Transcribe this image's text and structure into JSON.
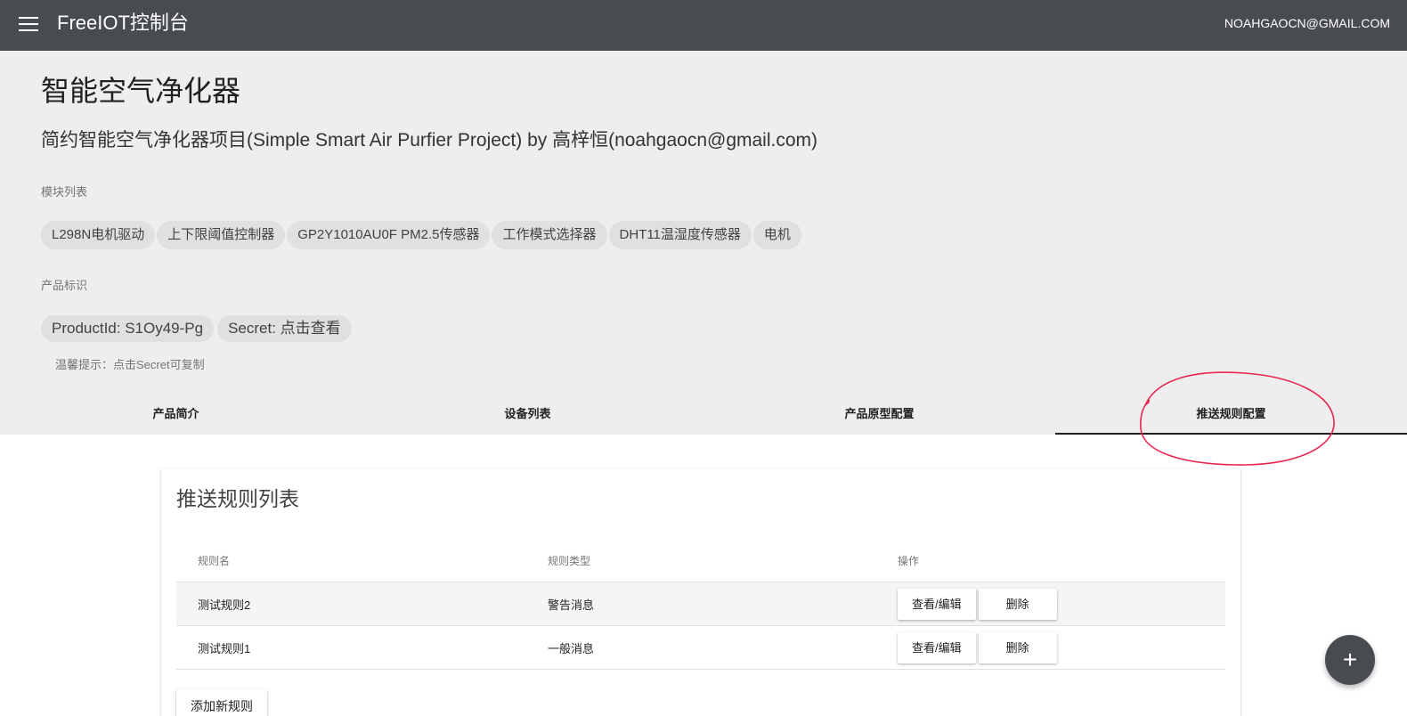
{
  "topbar": {
    "menu_icon": "menu-icon",
    "title": "FreeIOT控制台",
    "user_email": "NOAHGAOCN@GMAIL.COM"
  },
  "product": {
    "name": "智能空气净化器",
    "description": "简约智能空气净化器项目(Simple Smart Air Purfier Project) by 高梓恒(noahgaocn@gmail.com)",
    "modules_label": "模块列表",
    "modules": [
      "L298N电机驱动",
      "上下限阈值控制器",
      "GP2Y1010AU0F PM2.5传感器",
      "工作模式选择器",
      "DHT11温湿度传感器",
      "电机"
    ],
    "identity_label": "产品标识",
    "product_id": "ProductId: S1Oy49-Pg",
    "secret": "Secret: 点击查看",
    "hint": "温馨提示：点击Secret可复制"
  },
  "tabs": [
    {
      "label": "产品简介",
      "active": false
    },
    {
      "label": "设备列表",
      "active": false
    },
    {
      "label": "产品原型配置",
      "active": false
    },
    {
      "label": "推送规则配置",
      "active": true
    }
  ],
  "annotation_color": "#e8264f",
  "rules": {
    "title": "推送规则列表",
    "headers": [
      "规则名",
      "规则类型",
      "操作"
    ],
    "rows": [
      {
        "name": "测试规则2",
        "type": "警告消息",
        "view_label": "查看/编辑",
        "delete_label": "删除"
      },
      {
        "name": "测试规则1",
        "type": "一般消息",
        "view_label": "查看/编辑",
        "delete_label": "删除"
      }
    ],
    "add_label": "添加新规则"
  },
  "fab": {
    "label": "+",
    "icon": "plus-icon"
  }
}
